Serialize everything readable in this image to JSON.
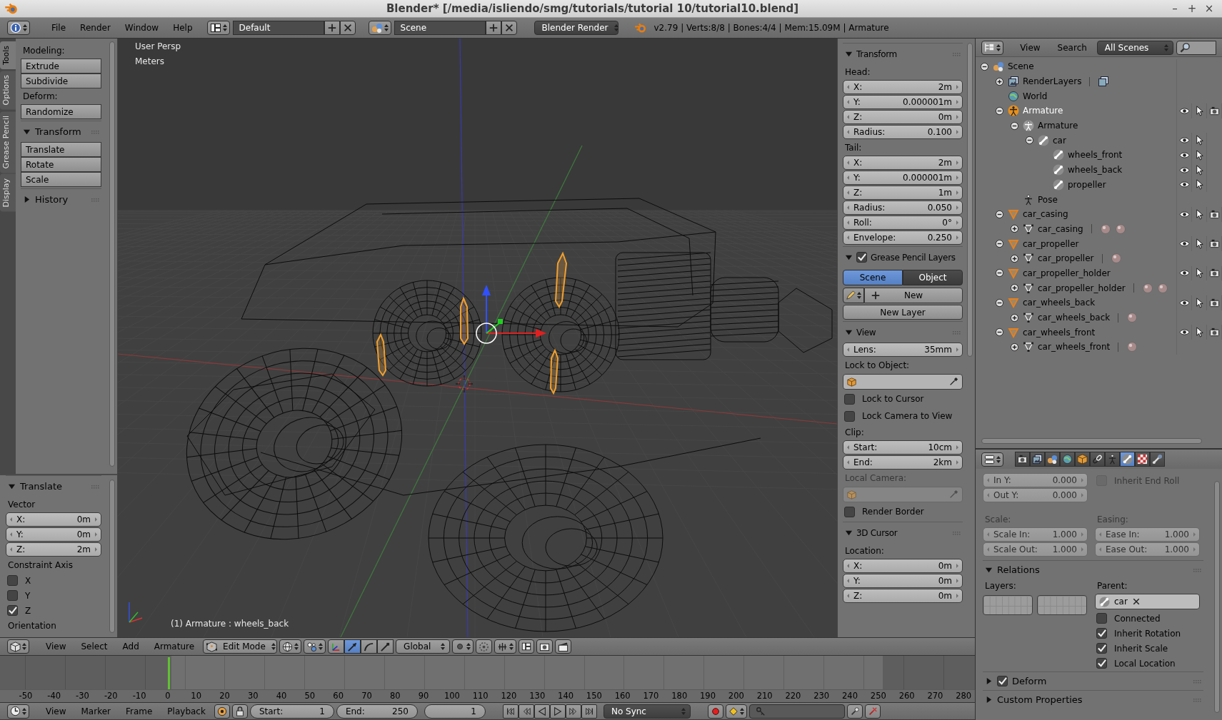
{
  "title_bar": {
    "title": "Blender* [/media/isliendo/smg/tutorials/tutorial 10/tutorial10.blend]",
    "controls": [
      "–",
      "+",
      "×"
    ]
  },
  "info_header": {
    "menus": [
      "File",
      "Render",
      "Window",
      "Help"
    ],
    "screen_layout": "Default",
    "scene": "Scene",
    "render_engine": "Blender Render",
    "stats": "v2.79 | Verts:8/8 | Bones:4/4 | Mem:15.09M | Armature"
  },
  "tool_shelf": {
    "tabs": [
      {
        "label": "Tools",
        "selected": true
      },
      {
        "label": "Options",
        "selected": false
      },
      {
        "label": "Grease Pencil",
        "selected": false
      },
      {
        "label": "Display",
        "selected": false
      }
    ],
    "rows": [
      {
        "kind": "label",
        "text": "Modeling:"
      },
      {
        "kind": "button",
        "text": "Extrude"
      },
      {
        "kind": "button",
        "text": "Subdivide"
      },
      {
        "kind": "label",
        "text": "Deform:"
      },
      {
        "kind": "button",
        "text": "Randomize"
      },
      {
        "kind": "panel",
        "text": "Transform",
        "expanded": true
      },
      {
        "kind": "button",
        "text": "Translate"
      },
      {
        "kind": "button",
        "text": "Rotate"
      },
      {
        "kind": "button",
        "text": "Scale"
      },
      {
        "kind": "panel",
        "text": "History",
        "expanded": false
      }
    ]
  },
  "operator_panel": {
    "rows": [
      {
        "kind": "panel",
        "text": "Translate",
        "expanded": true
      },
      {
        "kind": "label",
        "text": "Vector"
      },
      {
        "kind": "field",
        "label": "X:",
        "value": "0m"
      },
      {
        "kind": "field",
        "label": "Y:",
        "value": "0m"
      },
      {
        "kind": "field",
        "label": "Z:",
        "value": "2m"
      },
      {
        "kind": "label",
        "text": "Constraint Axis"
      },
      {
        "kind": "checkbox",
        "label": "X",
        "checked": false
      },
      {
        "kind": "checkbox",
        "label": "Y",
        "checked": false
      },
      {
        "kind": "checkbox",
        "label": "Z",
        "checked": true
      },
      {
        "kind": "label",
        "text": "Orientation"
      }
    ]
  },
  "viewport": {
    "view": "User Persp",
    "units": "Meters",
    "status": "(1) Armature : wheels_back"
  },
  "viewport_header": {
    "menus": [
      "View",
      "Select",
      "Add",
      "Armature"
    ],
    "mode": "Edit Mode",
    "manipulators": [
      {
        "kind": "translate",
        "selected": true
      },
      {
        "kind": "rotate",
        "selected": false
      },
      {
        "kind": "scale",
        "selected": false
      }
    ],
    "transform_orientation": "Global"
  },
  "n_panel": {
    "rows": [
      {
        "kind": "panel",
        "text": "Transform",
        "expanded": true
      },
      {
        "kind": "label",
        "text": "Head:",
        "disabled": false
      },
      {
        "kind": "field",
        "label": "X:",
        "value": "2m"
      },
      {
        "kind": "field",
        "label": "Y:",
        "value": "0.000001m"
      },
      {
        "kind": "field",
        "label": "Z:",
        "value": "0m"
      },
      {
        "kind": "field",
        "label": "Radius:",
        "value": "0.100"
      },
      {
        "kind": "label",
        "text": "Tail:",
        "disabled": false
      },
      {
        "kind": "field",
        "label": "X:",
        "value": "2m"
      },
      {
        "kind": "field",
        "label": "Y:",
        "value": "0.000001m"
      },
      {
        "kind": "field",
        "label": "Z:",
        "value": "1m"
      },
      {
        "kind": "field",
        "label": "Radius:",
        "value": "0.050"
      },
      {
        "kind": "field",
        "label": "Roll:",
        "value": "0°"
      },
      {
        "kind": "field",
        "label": "Envelope:",
        "value": "0.250"
      },
      {
        "kind": "panel",
        "text": "Grease Pencil Layers",
        "expanded": true,
        "checked": true
      },
      {
        "kind": "toggle",
        "options": [
          {
            "label": "Scene",
            "selected": true
          },
          {
            "label": "Object",
            "selected": false
          }
        ]
      },
      {
        "kind": "new",
        "text": "New"
      },
      {
        "kind": "button",
        "text": "New Layer"
      },
      {
        "kind": "panel",
        "text": "View",
        "expanded": true
      },
      {
        "kind": "field",
        "label": "Lens:",
        "value": "35mm"
      },
      {
        "kind": "label",
        "text": "Lock to Object:",
        "disabled": false
      },
      {
        "kind": "picker",
        "disabled": false
      },
      {
        "kind": "checkbox",
        "label": "Lock to Cursor",
        "checked": false
      },
      {
        "kind": "checkbox",
        "label": "Lock Camera to View",
        "checked": false
      },
      {
        "kind": "label",
        "text": "Clip:",
        "disabled": false
      },
      {
        "kind": "field",
        "label": "Start:",
        "value": "10cm"
      },
      {
        "kind": "field",
        "label": "End:",
        "value": "2km"
      },
      {
        "kind": "label",
        "text": "Local Camera:",
        "disabled": true
      },
      {
        "kind": "picker",
        "disabled": true
      },
      {
        "kind": "checkbox",
        "label": "Render Border",
        "checked": false
      },
      {
        "kind": "panel",
        "text": "3D Cursor",
        "expanded": true
      },
      {
        "kind": "label",
        "text": "Location:",
        "disabled": false
      },
      {
        "kind": "field",
        "label": "X:",
        "value": "0m"
      },
      {
        "kind": "field",
        "label": "Y:",
        "value": "0m"
      },
      {
        "kind": "field",
        "label": "Z:",
        "value": "0m"
      }
    ]
  },
  "outliner": {
    "menus": [
      "View",
      "Search"
    ],
    "filter": "All Scenes",
    "tree": [
      {
        "label": "Scene",
        "kind": "scene",
        "expanded": true,
        "selected": false,
        "children": [
          {
            "label": "RenderLayers",
            "kind": "render_layers",
            "expanded": false,
            "selected": false,
            "extras": [
              {
                "kind": "render_layer"
              }
            ]
          },
          {
            "label": "World",
            "kind": "world",
            "selected": false
          },
          {
            "label": "Armature",
            "kind": "armature_object",
            "expanded": true,
            "selected": true,
            "toggles": [
              {
                "kind": "visibility"
              },
              {
                "kind": "selection"
              },
              {
                "kind": "render"
              }
            ],
            "children": [
              {
                "label": "Armature",
                "kind": "armature_data",
                "expanded": true,
                "selected": false,
                "children": [
                  {
                    "label": "car",
                    "kind": "bone",
                    "expanded": true,
                    "selected": false,
                    "toggles": [
                      {
                        "kind": "visibility"
                      },
                      {
                        "kind": "selection"
                      }
                    ],
                    "children": [
                      {
                        "label": "wheels_front",
                        "kind": "bone",
                        "selected": false,
                        "toggles": [
                          {
                            "kind": "visibility"
                          },
                          {
                            "kind": "selection"
                          }
                        ]
                      },
                      {
                        "label": "wheels_back",
                        "kind": "bone",
                        "selected": false,
                        "toggles": [
                          {
                            "kind": "visibility"
                          },
                          {
                            "kind": "selection"
                          }
                        ]
                      },
                      {
                        "label": "propeller",
                        "kind": "bone",
                        "selected": false,
                        "toggles": [
                          {
                            "kind": "visibility"
                          },
                          {
                            "kind": "selection"
                          }
                        ]
                      }
                    ]
                  }
                ]
              },
              {
                "label": "Pose",
                "kind": "pose",
                "selected": false
              }
            ]
          },
          {
            "label": "car_casing",
            "kind": "mesh_object",
            "expanded": true,
            "selected": false,
            "toggles": [
              {
                "kind": "visibility"
              },
              {
                "kind": "selection"
              },
              {
                "kind": "render"
              }
            ],
            "children": [
              {
                "label": "car_casing",
                "kind": "mesh_data",
                "expanded": false,
                "selected": false,
                "extras": [
                  {
                    "kind": "material"
                  },
                  {
                    "kind": "material"
                  }
                ]
              }
            ]
          },
          {
            "label": "car_propeller",
            "kind": "mesh_object",
            "expanded": true,
            "selected": false,
            "toggles": [
              {
                "kind": "visibility"
              },
              {
                "kind": "selection"
              },
              {
                "kind": "render"
              }
            ],
            "children": [
              {
                "label": "car_propeller",
                "kind": "mesh_data",
                "expanded": false,
                "selected": false,
                "extras": [
                  {
                    "kind": "material"
                  }
                ]
              }
            ]
          },
          {
            "label": "car_propeller_holder",
            "kind": "mesh_object",
            "expanded": true,
            "selected": false,
            "toggles": [
              {
                "kind": "visibility"
              },
              {
                "kind": "selection"
              },
              {
                "kind": "render"
              }
            ],
            "children": [
              {
                "label": "car_propeller_holder",
                "kind": "mesh_data",
                "expanded": false,
                "selected": false,
                "extras": [
                  {
                    "kind": "material"
                  },
                  {
                    "kind": "material"
                  }
                ]
              }
            ]
          },
          {
            "label": "car_wheels_back",
            "kind": "mesh_object",
            "expanded": true,
            "selected": false,
            "toggles": [
              {
                "kind": "visibility"
              },
              {
                "kind": "selection"
              },
              {
                "kind": "render"
              }
            ],
            "children": [
              {
                "label": "car_wheels_back",
                "kind": "mesh_data",
                "expanded": false,
                "selected": false,
                "extras": [
                  {
                    "kind": "material"
                  }
                ]
              }
            ]
          },
          {
            "label": "car_wheels_front",
            "kind": "mesh_object",
            "expanded": true,
            "selected": false,
            "toggles": [
              {
                "kind": "visibility"
              },
              {
                "kind": "selection"
              },
              {
                "kind": "render"
              }
            ],
            "children": [
              {
                "label": "car_wheels_front",
                "kind": "mesh_data",
                "expanded": false,
                "selected": false,
                "extras": [
                  {
                    "kind": "material"
                  }
                ]
              }
            ]
          }
        ]
      }
    ]
  },
  "properties": {
    "tabs": [
      {
        "kind": "render",
        "selected": false
      },
      {
        "kind": "render_layers",
        "selected": false
      },
      {
        "kind": "scene",
        "selected": false
      },
      {
        "kind": "world",
        "selected": false
      },
      {
        "kind": "object",
        "selected": false
      },
      {
        "kind": "constraints",
        "selected": false
      },
      {
        "kind": "armature",
        "selected": false
      },
      {
        "kind": "bone",
        "selected": true
      },
      {
        "kind": "texture",
        "selected": false
      },
      {
        "kind": "bone_constraints",
        "selected": false
      }
    ],
    "bendy_bones": {
      "disabled": true,
      "curve_fields": [
        {
          "label": "In Y:",
          "value": "0.000"
        },
        {
          "label": "Out Y:",
          "value": "0.000"
        }
      ],
      "inherit_end_roll": {
        "label": "Inherit End Roll",
        "checked": false
      },
      "scale_label": "Scale:",
      "scale_fields": [
        {
          "label": "Scale In:",
          "value": "1.000"
        },
        {
          "label": "Scale Out:",
          "value": "1.000"
        }
      ],
      "easing_label": "Easing:",
      "easing_fields": [
        {
          "label": "Ease In:",
          "value": "1.000"
        },
        {
          "label": "Ease Out:",
          "value": "1.000"
        }
      ]
    },
    "relations": {
      "title": "Relations",
      "expanded": true,
      "layers_label": "Layers:",
      "parent_label": "Parent:",
      "parent": "car",
      "options": [
        {
          "label": "Connected",
          "checked": false
        },
        {
          "label": "Inherit Rotation",
          "checked": true
        },
        {
          "label": "Inherit Scale",
          "checked": true
        },
        {
          "label": "Local Location",
          "checked": true
        }
      ]
    },
    "collapsed_panels": [
      {
        "title": "Deform",
        "expanded": false,
        "checked": true
      },
      {
        "title": "Custom Properties",
        "expanded": false
      }
    ]
  },
  "timeline": {
    "ruler": [
      "-50",
      "-40",
      "-30",
      "-20",
      "-10",
      "0",
      "10",
      "20",
      "30",
      "40",
      "50",
      "60",
      "70",
      "80",
      "90",
      "100",
      "110",
      "120",
      "130",
      "140",
      "150",
      "160",
      "170",
      "180",
      "190",
      "200",
      "210",
      "220",
      "230",
      "240",
      "250",
      "260",
      "270",
      "280"
    ]
  },
  "timeline_header": {
    "menus": [
      "View",
      "Marker",
      "Frame",
      "Playback"
    ],
    "start_label": "Start:",
    "start": "1",
    "end_label": "End:",
    "end": "250",
    "current_frame": "1",
    "sync": "No Sync"
  }
}
